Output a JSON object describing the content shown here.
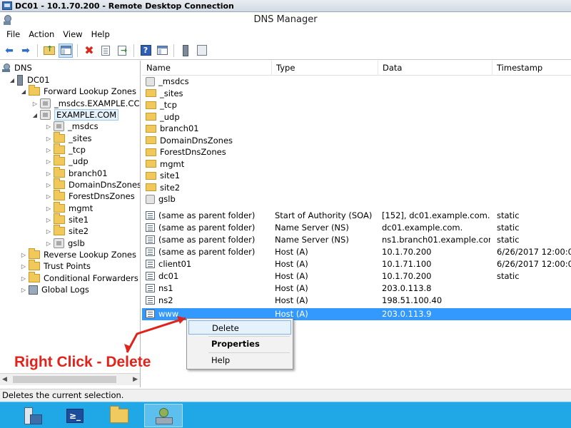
{
  "rdp": {
    "title": "DC01 - 10.1.70.200 - Remote Desktop Connection"
  },
  "app": {
    "title": "DNS Manager"
  },
  "menu": [
    "File",
    "Action",
    "View",
    "Help"
  ],
  "toolbar": {
    "icons": [
      "back-arrow-icon",
      "forward-arrow-icon",
      "up-folder-icon",
      "show-hide-tree-icon",
      "delete-icon",
      "properties-icon",
      "export-list-icon",
      "help-icon",
      "action-pane-icon",
      "server-icon",
      "server-settings-icon"
    ]
  },
  "tree": {
    "root": "DNS",
    "server": "DC01",
    "forward_zones": "Forward Lookup Zones",
    "msdcs_zone": "_msdcs.EXAMPLE.CC",
    "example_zone": "EXAMPLE.COM",
    "children": [
      "_msdcs",
      "_sites",
      "_tcp",
      "_udp",
      "branch01",
      "DomainDnsZones",
      "ForestDnsZones",
      "mgmt",
      "site1",
      "site2",
      "gslb"
    ],
    "reverse_zones": "Reverse Lookup Zones",
    "trust_points": "Trust Points",
    "conditional_forwarders": "Conditional Forwarders",
    "global_logs": "Global Logs"
  },
  "list": {
    "headers": {
      "name": "Name",
      "type": "Type",
      "data": "Data",
      "timestamp": "Timestamp"
    },
    "rows": [
      {
        "name": "_msdcs",
        "type": "",
        "data": "",
        "ts": ""
      },
      {
        "name": "_sites",
        "type": "",
        "data": "",
        "ts": ""
      },
      {
        "name": "_tcp",
        "type": "",
        "data": "",
        "ts": ""
      },
      {
        "name": "_udp",
        "type": "",
        "data": "",
        "ts": ""
      },
      {
        "name": "branch01",
        "type": "",
        "data": "",
        "ts": ""
      },
      {
        "name": "DomainDnsZones",
        "type": "",
        "data": "",
        "ts": ""
      },
      {
        "name": "ForestDnsZones",
        "type": "",
        "data": "",
        "ts": ""
      },
      {
        "name": "mgmt",
        "type": "",
        "data": "",
        "ts": ""
      },
      {
        "name": "site1",
        "type": "",
        "data": "",
        "ts": ""
      },
      {
        "name": "site2",
        "type": "",
        "data": "",
        "ts": ""
      },
      {
        "name": "gslb",
        "type": "",
        "data": "",
        "ts": ""
      },
      {
        "name": "(same as parent folder)",
        "type": "Start of Authority (SOA)",
        "data": "[152], dc01.example.com.,...",
        "ts": "static"
      },
      {
        "name": "(same as parent folder)",
        "type": "Name Server (NS)",
        "data": "dc01.example.com.",
        "ts": "static"
      },
      {
        "name": "(same as parent folder)",
        "type": "Name Server (NS)",
        "data": "ns1.branch01.example.com.",
        "ts": "static"
      },
      {
        "name": "(same as parent folder)",
        "type": "Host (A)",
        "data": "10.1.70.200",
        "ts": "6/26/2017 12:00:00 A"
      },
      {
        "name": "client01",
        "type": "Host (A)",
        "data": "10.1.71.100",
        "ts": "6/26/2017 12:00:00 A"
      },
      {
        "name": "dc01",
        "type": "Host (A)",
        "data": "10.1.70.200",
        "ts": "static"
      },
      {
        "name": "ns1",
        "type": "Host (A)",
        "data": "203.0.113.8",
        "ts": ""
      },
      {
        "name": "ns2",
        "type": "Host (A)",
        "data": "198.51.100.40",
        "ts": ""
      },
      {
        "name": "www",
        "type": "Host (A)",
        "data": "203.0.113.9",
        "ts": ""
      }
    ]
  },
  "context_menu": {
    "delete": "Delete",
    "properties": "Properties",
    "help": "Help"
  },
  "annotation": {
    "text": "Right Click - Delete",
    "color": "#e0231b"
  },
  "status": {
    "text": "Deletes the current selection."
  },
  "colors": {
    "selection": "#3399ff",
    "taskbar": "#1fa7e6"
  },
  "taskbar": {
    "icons": [
      "server-manager-icon",
      "powershell-icon",
      "file-explorer-icon",
      "dns-manager-icon"
    ]
  }
}
